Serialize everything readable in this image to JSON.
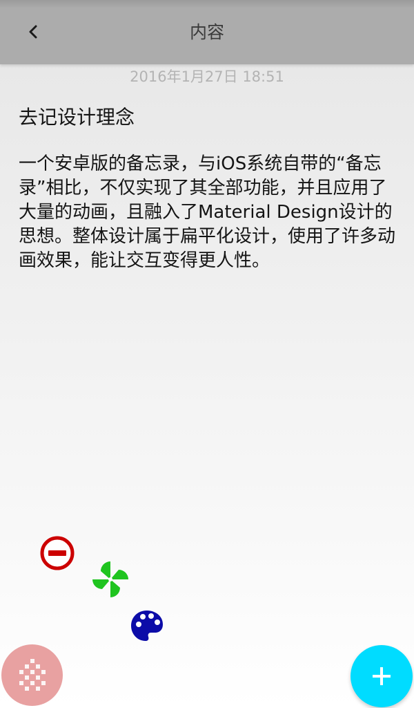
{
  "app_bar": {
    "title": "内容",
    "back_icon": "chevron-left-icon"
  },
  "note": {
    "date": "2016年1月27日 18:51",
    "heading": "去记设计理念",
    "paragraph": "一个安卓版的备忘录，与iOS系统自带的“备忘录”相比，不仅实现了其全部功能，并且应用了大量的动画，且融入了Material Design设计的思想。整体设计属于扁平化设计，使用了许多动画效果，能让交互变得更人性。"
  },
  "actions": {
    "delete_icon": "minus-circle-icon",
    "pinwheel_icon": "pinwheel-icon",
    "palette_icon": "palette-icon",
    "menu_icon": "dot-grid-icon",
    "add_icon": "plus-icon"
  },
  "colors": {
    "app_bar": "#acacac",
    "delete": "#cc0000",
    "pinwheel": "#1fc41f",
    "palette": "#0c0ca8",
    "add_fab": "#00dcff",
    "menu_fab": "#e8a1a1"
  }
}
